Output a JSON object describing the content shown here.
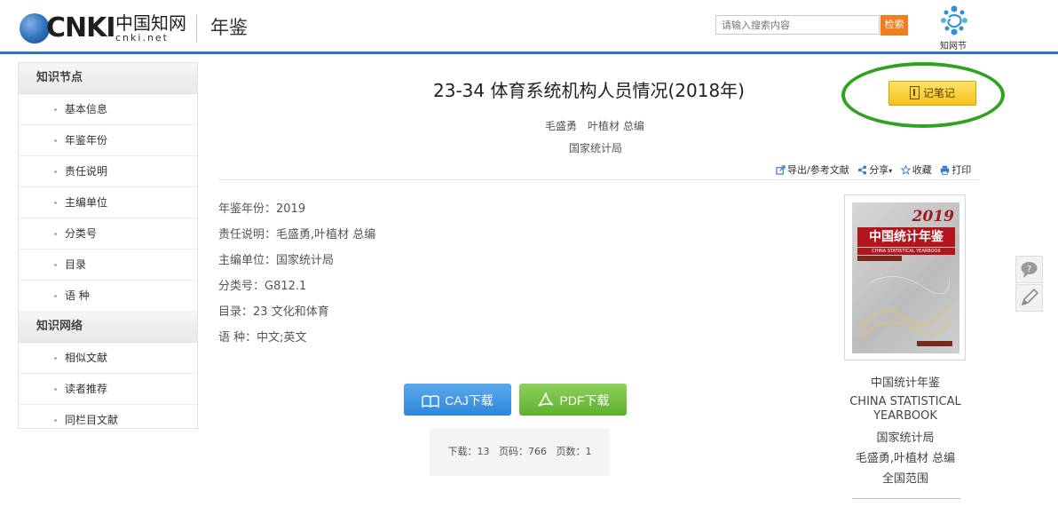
{
  "header": {
    "logo_text": "CNKI",
    "logo_cn": "中国知网",
    "logo_sub": "cnki.net",
    "section_title": "年鉴",
    "search": {
      "placeholder": "请输入搜索内容",
      "button_label": "检索"
    },
    "zhiwangjie_label": "知网节"
  },
  "sidebar": {
    "groups": [
      {
        "title": "知识节点",
        "items": [
          "基本信息",
          "年鉴年份",
          "责任说明",
          "主编单位",
          "分类号",
          "目录",
          "语 种"
        ]
      },
      {
        "title": "知识网络",
        "items": [
          "相似文献",
          "读者推荐",
          "同栏目文献"
        ]
      }
    ]
  },
  "article": {
    "title": "23-34 体育系统机构人员情况(2018年)",
    "editors": "毛盛勇　叶植材 总编",
    "organization": "国家统计局",
    "note_button_label": "记笔记"
  },
  "toolbar": {
    "export_label": "导出/参考文献",
    "share_label": "分享",
    "favorite_label": "收藏",
    "print_label": "打印"
  },
  "meta": [
    {
      "key": "年鉴年份：",
      "value": "2019"
    },
    {
      "key": "责任说明：",
      "value": "毛盛勇,叶植材 总编"
    },
    {
      "key": "主编单位：",
      "value": "国家统计局"
    },
    {
      "key": "分类号：",
      "value": "G812.1"
    },
    {
      "key": "目录：",
      "value": "23 文化和体育"
    },
    {
      "key": "语 种：",
      "value": "中文;英文"
    }
  ],
  "downloads": {
    "caj_label": "CAJ下载",
    "pdf_label": "PDF下载"
  },
  "stats": {
    "downloads_label": "下载：",
    "downloads": "13",
    "page_label": "页码：",
    "page": "766",
    "pages_label": "页数：",
    "pages": "1"
  },
  "book": {
    "cover_year": "2019",
    "cover_title": "中国统计年鉴",
    "cover_subtitle": "CHINA STATISTICAL YEARBOOK",
    "name_cn": "中国统计年鉴",
    "name_en": "CHINA STATISTICAL YEARBOOK",
    "publisher": "国家统计局",
    "editors": "毛盛勇,叶植材 总编",
    "scope": "全国范围"
  },
  "colors": {
    "brand_blue": "#2d73c6",
    "search_orange": "#f07d1e",
    "note_yellow": "#f4c21a",
    "highlight_green": "#2ea41e",
    "caj_blue": "#2f86d8",
    "pdf_green": "#5fb02f",
    "cover_red": "#b3151d"
  }
}
